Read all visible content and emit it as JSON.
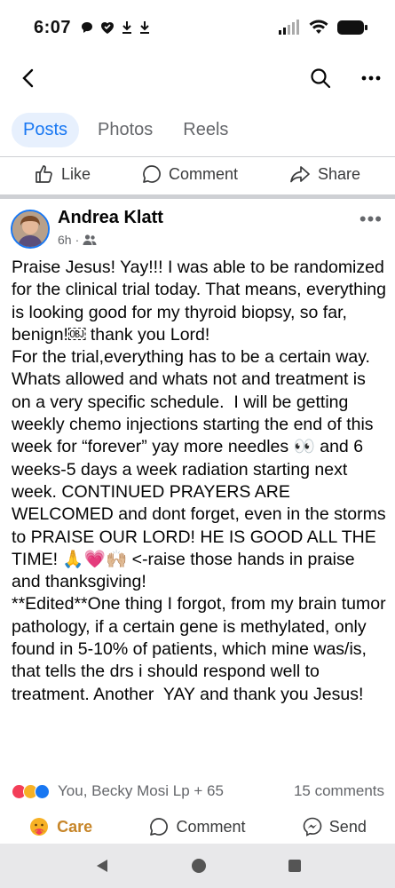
{
  "status": {
    "time": "6:07"
  },
  "tabs": [
    {
      "label": "Posts",
      "active": true
    },
    {
      "label": "Photos",
      "active": false
    },
    {
      "label": "Reels",
      "active": false
    }
  ],
  "top_actions": {
    "like": "Like",
    "comment": "Comment",
    "share": "Share"
  },
  "post": {
    "author": "Andrea Klatt",
    "time": "6h",
    "audience_icon": "friends-icon",
    "body": "Praise Jesus! Yay!!! I was able to be randomized for the clinical trial today. That means, everything is looking good for my thyroid biopsy, so far, benign!￼ thank you Lord!\nFor the trial,everything has to be a certain way. Whats allowed and whats not and treatment is on a very specific schedule.  I will be getting weekly chemo injections starting the end of this week for “forever” yay more needles 👀 and 6 weeks-5 days a week radiation starting next week. CONTINUED PRAYERS ARE WELCOMED and dont forget, even in the storms to PRAISE OUR LORD! HE IS GOOD ALL THE TIME! 🙏💗🙌🏼 <-raise those hands in praise and thanksgiving!\n**Edited**One thing I forgot, from my brain tumor pathology, if a certain gene is methylated, only found in 5-10% of patients, which mine was/is, that tells the drs i should respond well to treatment. Another  YAY and thank you Jesus!",
    "reactions_text": "You, Becky Mosi Lp + 65",
    "comments_text": "15 comments"
  },
  "bottom_actions": {
    "care": "Care",
    "comment": "Comment",
    "send": "Send"
  },
  "colors": {
    "accent": "#1877f2",
    "care": "#c7862a",
    "love": "#f33e58",
    "like": "#1877f2"
  }
}
